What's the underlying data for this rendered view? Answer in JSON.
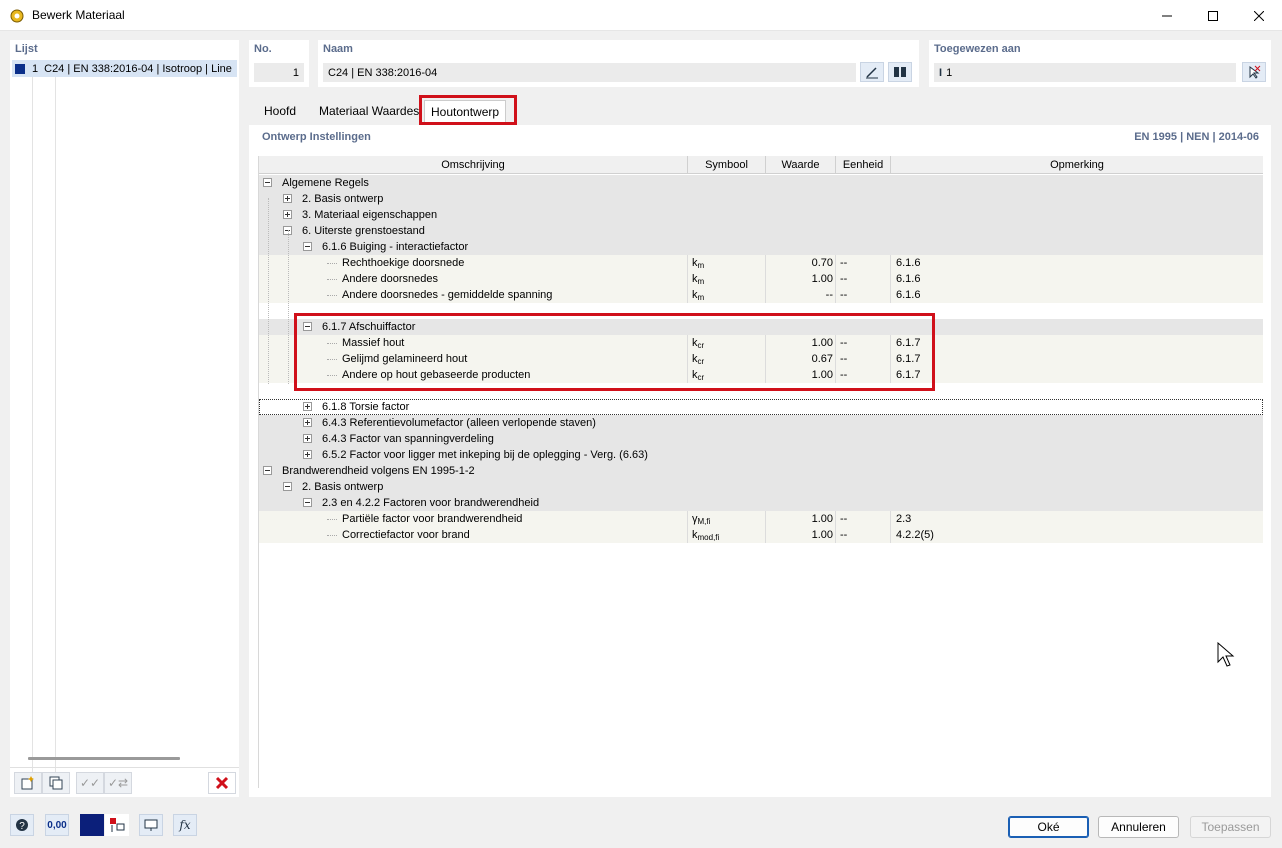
{
  "window": {
    "title": "Bewerk Materiaal"
  },
  "left": {
    "title": "Lijst",
    "item": {
      "no": "1",
      "label": "C24 | EN 338:2016-04 | Isotroop | Line"
    }
  },
  "no": {
    "label": "No.",
    "value": "1"
  },
  "naam": {
    "label": "Naam",
    "value": "C24 | EN 338:2016-04"
  },
  "toegewezen": {
    "label": "Toegewezen aan",
    "value": "1"
  },
  "tabs": [
    "Hoofd",
    "Materiaal Waardes",
    "Houtontwerp"
  ],
  "active_tab": "Houtontwerp",
  "main": {
    "heading": "Ontwerp Instellingen",
    "standard": "EN 1995 | NEN | 2014-06"
  },
  "columns": [
    "Omschrijving",
    "Symbool",
    "Waarde",
    "Eenheid",
    "Opmerking"
  ],
  "rows": [
    {
      "level": 0,
      "toggle": "minus",
      "label": "Algemene Regels",
      "bg": "g"
    },
    {
      "level": 1,
      "toggle": "plus",
      "label": "2. Basis ontwerp",
      "bg": "g"
    },
    {
      "level": 1,
      "toggle": "plus",
      "label": "3. Materiaal eigenschappen",
      "bg": "g"
    },
    {
      "level": 1,
      "toggle": "minus",
      "label": "6. Uiterste grenstoestand",
      "bg": "g"
    },
    {
      "level": 2,
      "toggle": "minus",
      "label": "6.1.6 Buiging - interactiefactor",
      "bg": "g"
    },
    {
      "level": 3,
      "label": "Rechthoekige doorsnede",
      "sym": "k",
      "sub": "m",
      "value": "0.70",
      "unit": "--",
      "note": "6.1.6",
      "bg": "f"
    },
    {
      "level": 3,
      "label": "Andere doorsnedes",
      "sym": "k",
      "sub": "m",
      "value": "1.00",
      "unit": "--",
      "note": "6.1.6",
      "bg": "f"
    },
    {
      "level": 3,
      "label": "Andere doorsnedes - gemiddelde spanning",
      "sym": "k",
      "sub": "m",
      "value": "--",
      "unit": "--",
      "note": "6.1.6",
      "bg": "f"
    },
    {
      "level": -1,
      "label": "",
      "bg": "w"
    },
    {
      "level": 2,
      "toggle": "minus",
      "label": "6.1.7 Afschuiffactor",
      "bg": "g"
    },
    {
      "level": 3,
      "label": "Massief hout",
      "sym": "k",
      "sub": "cr",
      "value": "1.00",
      "unit": "--",
      "note": "6.1.7",
      "bg": "f"
    },
    {
      "level": 3,
      "label": "Gelijmd gelamineerd hout",
      "sym": "k",
      "sub": "cr",
      "value": "0.67",
      "unit": "--",
      "note": "6.1.7",
      "bg": "f"
    },
    {
      "level": 3,
      "label": "Andere op hout gebaseerde producten",
      "sym": "k",
      "sub": "cr",
      "value": "1.00",
      "unit": "--",
      "note": "6.1.7",
      "bg": "f"
    },
    {
      "level": -1,
      "label": "",
      "bg": "w"
    },
    {
      "level": 2,
      "toggle": "plus",
      "label": "6.1.8 Torsie factor",
      "bg": "sel"
    },
    {
      "level": 2,
      "toggle": "plus",
      "label": "6.4.3 Referentievolumefactor (alleen verlopende staven)",
      "bg": "g"
    },
    {
      "level": 2,
      "toggle": "plus",
      "label": "6.4.3 Factor van spanningverdeling",
      "bg": "g"
    },
    {
      "level": 2,
      "toggle": "plus",
      "label": "6.5.2 Factor voor ligger met inkeping bij de oplegging - Verg. (6.63)",
      "bg": "g"
    },
    {
      "level": 0,
      "toggle": "minus",
      "label": "Brandwerendheid volgens EN 1995-1-2",
      "bg": "g"
    },
    {
      "level": 1,
      "toggle": "minus",
      "label": "2. Basis ontwerp",
      "bg": "g"
    },
    {
      "level": 2,
      "toggle": "minus",
      "label": "2.3 en 4.2.2 Factoren voor brandwerendheid",
      "bg": "g"
    },
    {
      "level": 3,
      "label": "Partiële factor voor brandwerendheid",
      "sym": "γ",
      "sub": "M,fi",
      "value": "1.00",
      "unit": "--",
      "note": "2.3",
      "bg": "f"
    },
    {
      "level": 3,
      "label": "Correctiefactor voor brand",
      "sym": "k",
      "sub": "mod,fi",
      "value": "1.00",
      "unit": "--",
      "note": "4.2.2(5)",
      "bg": "f"
    }
  ],
  "bottom": {
    "value_label": "0,00",
    "ok": "Oké",
    "cancel": "Annuleren",
    "apply": "Toepassen"
  },
  "colors": {
    "accent": "#5b6c8c",
    "highlight": "#d0101a",
    "swatch": "#0b2f8a"
  }
}
